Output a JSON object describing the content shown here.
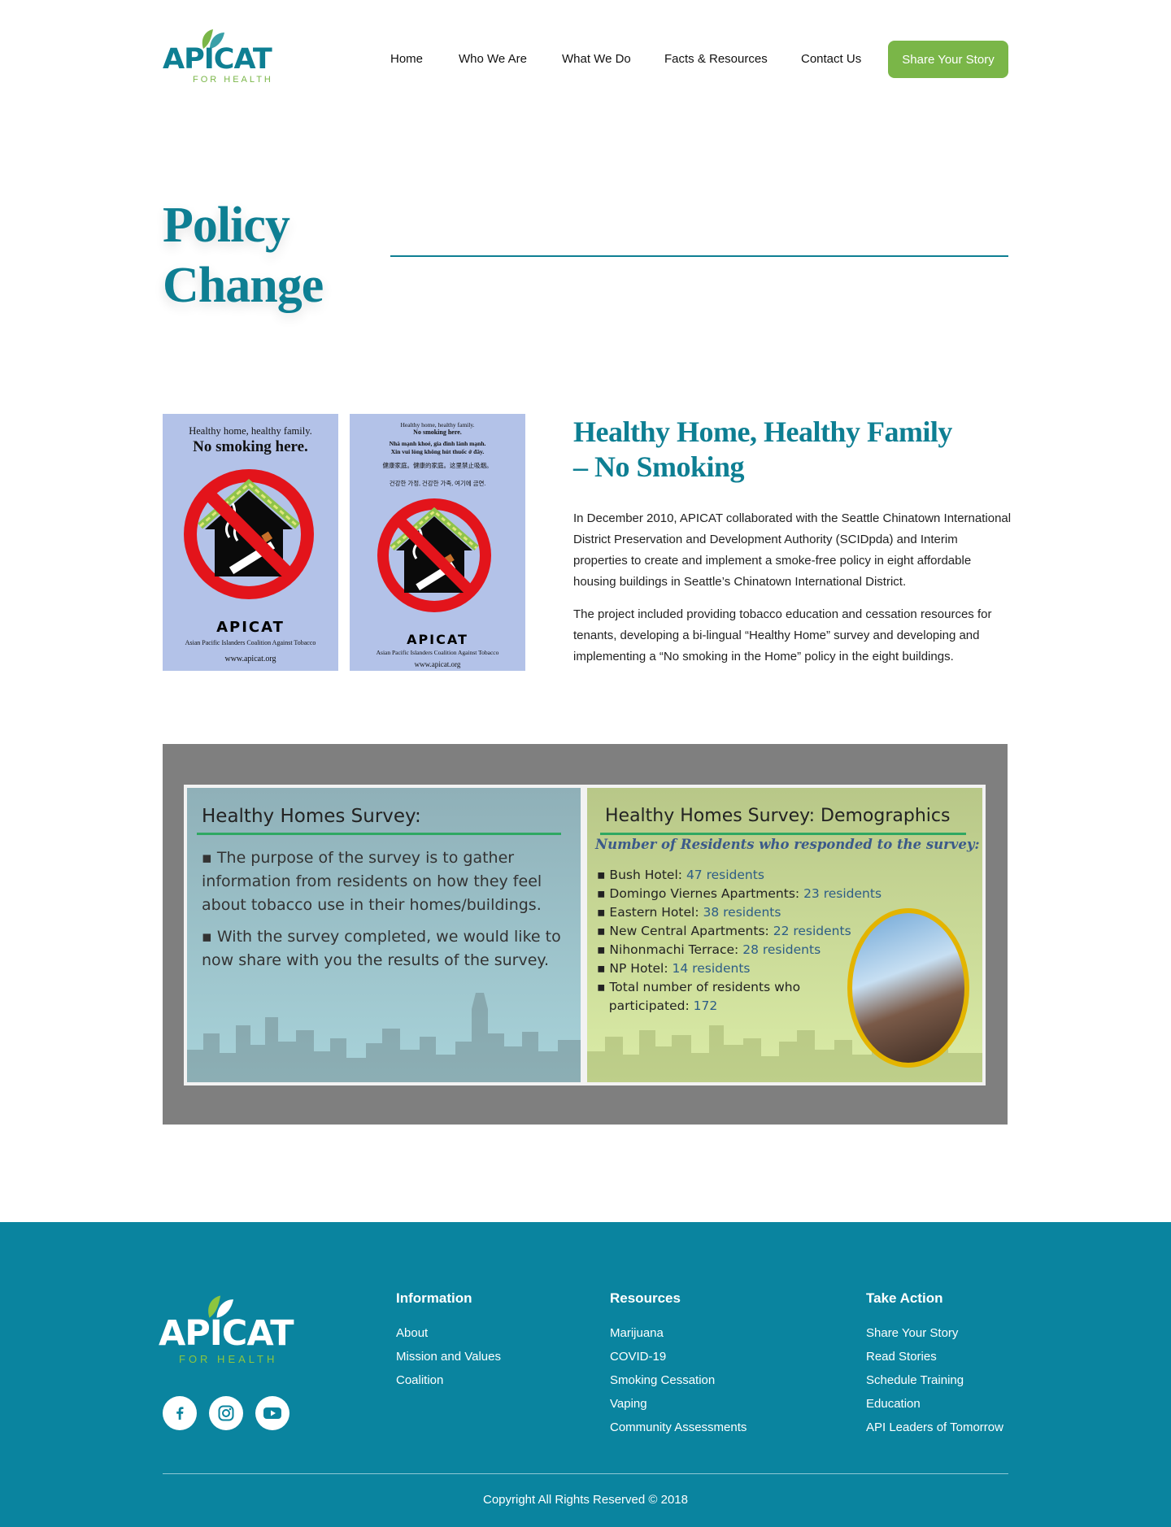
{
  "header": {
    "logo_word": "APICAT",
    "logo_sub": "FOR HEALTH",
    "nav": [
      "Home",
      "Who We Are",
      "What We Do",
      "Facts & Resources",
      "Contact Us"
    ],
    "cta_label": "Share Your Story"
  },
  "hero": {
    "title_line1": "Policy",
    "title_line2": "Change"
  },
  "posters": {
    "poster1": {
      "line1": "Healthy home, healthy family.",
      "line2": "No smoking here.",
      "brand": "APICAT",
      "org": "Asian Pacific Islanders Coalition Against Tobacco",
      "url": "www.apicat.org"
    },
    "poster2": {
      "line1": "Healthy home, healthy family.",
      "line2": "No smoking here.",
      "vi1": "Nhà mạnh khoẻ, gia đình lành mạnh.",
      "vi2": "Xin vui lòng không hút thuốc ở đây.",
      "zh": "健康家庭。健康的家庭。这里禁止吸烟。",
      "ko": "건강한 가정, 건강한 가족, 여기에 금연.",
      "brand": "APICAT",
      "org": "Asian Pacific Islanders Coalition Against Tobacco",
      "url": "www.apicat.org"
    }
  },
  "article": {
    "title_line1": "Healthy Home, Healthy Family",
    "title_line2": "– No Smoking",
    "para1": "In December 2010, APICAT collaborated with the Seattle Chinatown International District Preservation and Development Authority (SCIDpda) and Interim properties to create and implement a smoke-free policy in eight affordable housing buildings in Seattle’s Chinatown International District.",
    "para2": "The project included providing tobacco education and cessation resources for tenants, developing a bi-lingual “Healthy Home” survey and developing and implementing a “No smoking in the Home” policy in the eight buildings."
  },
  "slides": {
    "left": {
      "title": "Healthy Homes Survey:",
      "bullet1": "▪ The purpose of the survey is to gather information from residents on how they feel about tobacco use in their homes/buildings.",
      "bullet2": "▪ With the survey completed, we would like to now share with you the results of the survey."
    },
    "right": {
      "title": "Healthy Homes Survey: Demographics",
      "subhead": "Number of Residents who responded to the survey:",
      "items": [
        {
          "name": "▪ Bush Hotel:",
          "value": "47 residents"
        },
        {
          "name": "▪ Domingo Viernes Apartments:",
          "value": "23 residents"
        },
        {
          "name": "▪ Eastern Hotel:",
          "value": "38 residents"
        },
        {
          "name": "▪ New Central Apartments:",
          "value": "22 residents"
        },
        {
          "name": "▪ Nihonmachi Terrace:",
          "value": "28 residents"
        },
        {
          "name": "▪ NP Hotel:",
          "value": "14 residents"
        }
      ],
      "total_line1": "▪ Total number of residents who",
      "total_line2_label": "participated:",
      "total_value": "172"
    }
  },
  "footer": {
    "logo_word": "APICAT",
    "logo_sub": "FOR HEALTH",
    "social": [
      "facebook-icon",
      "instagram-icon",
      "youtube-icon"
    ],
    "columns": [
      {
        "heading": "Information",
        "links": [
          "About",
          "Mission and Values",
          "Coalition"
        ]
      },
      {
        "heading": "Resources",
        "links": [
          "Marijuana",
          "COVID-19",
          "Smoking Cessation",
          "Vaping",
          "Community Assessments"
        ]
      },
      {
        "heading": "Take Action",
        "links": [
          "Share Your Story",
          "Read Stories",
          "Schedule Training",
          "Education",
          "API Leaders of Tomorrow"
        ]
      }
    ],
    "copyright": "Copyright All Rights Reserved © 2018"
  },
  "colors": {
    "brand_teal": "#0e7f93",
    "brand_green": "#7ab648",
    "footer_bg": "#0a849f",
    "poster_bg": "#b3c2e8"
  }
}
